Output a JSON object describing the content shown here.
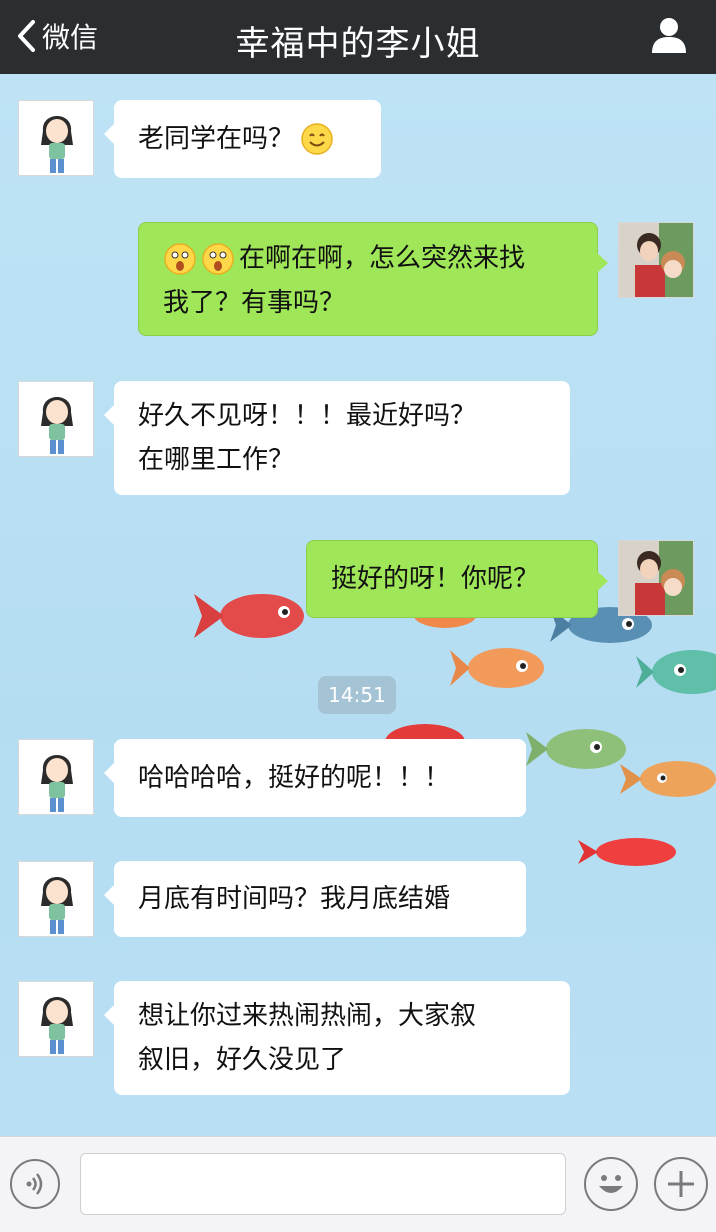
{
  "header": {
    "back_label": "微信",
    "title": "幸福中的李小姐"
  },
  "messages": [
    {
      "side": "left",
      "text": "老同学在吗？",
      "emoji": "smile-emoji"
    },
    {
      "side": "right",
      "emoji": "surprised-emoji",
      "line1": "在啊在啊，怎么突然来找",
      "line2": "我了？有事吗？"
    },
    {
      "side": "left",
      "line1": "好久不见呀！！！最近好吗？",
      "line2": "在哪里工作？"
    },
    {
      "side": "right",
      "text": "挺好的呀！你呢？"
    },
    {
      "side": "left",
      "text": "哈哈哈哈，挺好的呢！！！"
    },
    {
      "side": "left",
      "text": "月底有时间吗？我月底结婚"
    },
    {
      "side": "left",
      "line1": "想让你过来热闹热闹，大家叙",
      "line2": "叙旧，好久没见了"
    }
  ],
  "timestamp": "14:51",
  "input": {
    "value": "",
    "placeholder": ""
  },
  "icons": {
    "back": "chevron-left-icon",
    "user": "user-profile-icon",
    "voice": "voice-icon",
    "emoji": "emoji-icon",
    "plus": "plus-icon"
  },
  "colors": {
    "nav_bg": "#2b2e31",
    "bubble_self": "#9fe658",
    "bubble_other": "#ffffff",
    "chat_bg": "#bfe3f5"
  }
}
